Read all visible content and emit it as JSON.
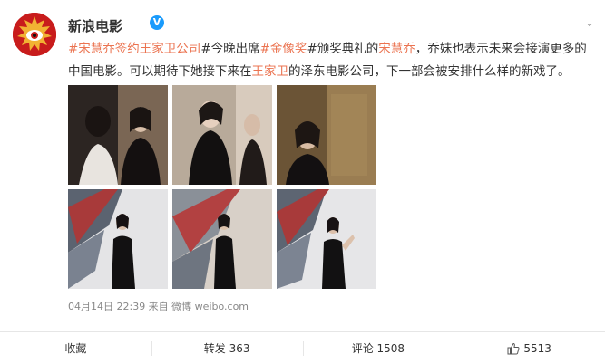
{
  "post": {
    "username": "新浪电影",
    "text_segments": [
      {
        "text": "#宋慧乔签约王家卫公司",
        "kind": "tag"
      },
      {
        "text": "#今晚出席",
        "kind": "plain"
      },
      {
        "text": "#金像奖",
        "kind": "tag"
      },
      {
        "text": "#颁奖典礼的",
        "kind": "plain"
      },
      {
        "text": "宋慧乔",
        "kind": "mention"
      },
      {
        "text": "，乔妹也表示未来会接演更多的中国电影。可以期待下她接下来在",
        "kind": "plain"
      },
      {
        "text": "王家卫",
        "kind": "mention"
      },
      {
        "text": "的泽东电影公司，下一部会被安排什么样的新戏了。",
        "kind": "plain"
      }
    ],
    "meta": "04月14日 22:39 来自 微博 weibo.com"
  },
  "actions": {
    "favorite": "收藏",
    "repost": "转发 363",
    "comment": "评论 1508",
    "like": "5513"
  },
  "colors": {
    "accent": "#eb7350",
    "verified": "#1a9bfc",
    "avatar": "#c81c1c"
  },
  "icons": {
    "verified": "verified-badge-icon",
    "like": "thumbs-up-icon",
    "dropdown": "chevron-down-icon"
  }
}
